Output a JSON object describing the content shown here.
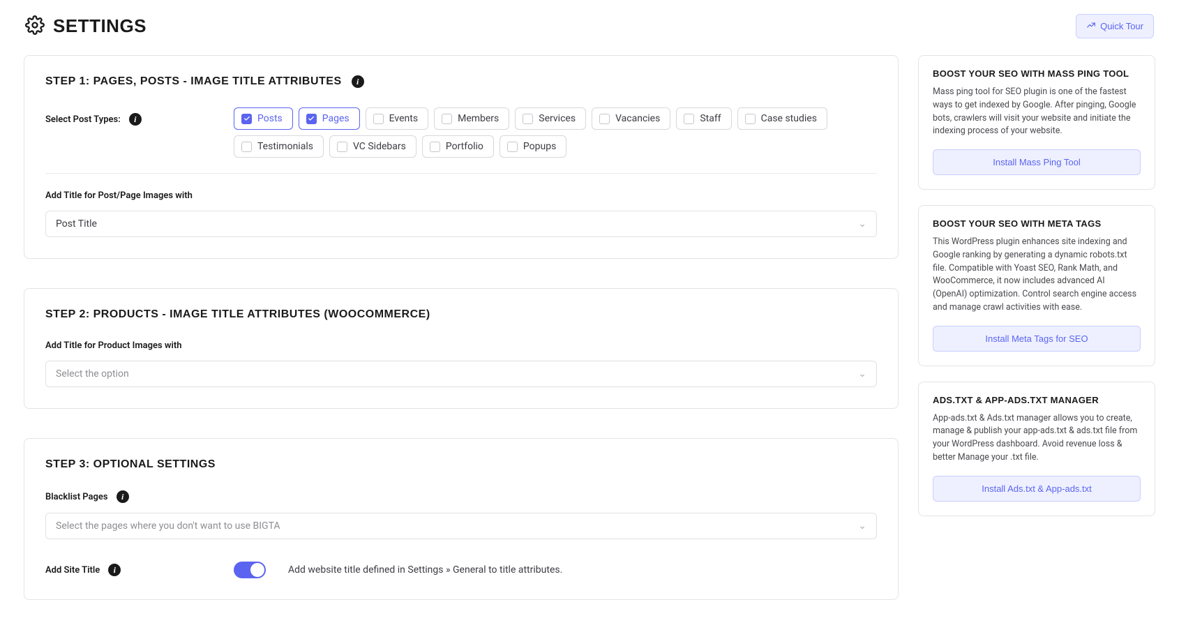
{
  "header": {
    "title": "SETTINGS",
    "quick_tour_label": "Quick Tour"
  },
  "step1": {
    "title": "STEP 1: PAGES, POSTS - IMAGE TITLE ATTRIBUTES",
    "select_post_types_label": "Select Post Types:",
    "post_types": [
      {
        "label": "Posts",
        "checked": true
      },
      {
        "label": "Pages",
        "checked": true
      },
      {
        "label": "Events",
        "checked": false
      },
      {
        "label": "Members",
        "checked": false
      },
      {
        "label": "Services",
        "checked": false
      },
      {
        "label": "Vacancies",
        "checked": false
      },
      {
        "label": "Staff",
        "checked": false
      },
      {
        "label": "Case studies",
        "checked": false
      },
      {
        "label": "Testimonials",
        "checked": false
      },
      {
        "label": "VC Sidebars",
        "checked": false
      },
      {
        "label": "Portfolio",
        "checked": false
      },
      {
        "label": "Popups",
        "checked": false
      }
    ],
    "add_title_label": "Add Title for Post/Page Images with",
    "add_title_value": "Post Title"
  },
  "step2": {
    "title": "STEP 2: PRODUCTS - IMAGE TITLE ATTRIBUTES (WOOCOMMERCE)",
    "add_title_label": "Add Title for Product Images with",
    "add_title_placeholder": "Select the option"
  },
  "step3": {
    "title": "STEP 3: OPTIONAL SETTINGS",
    "blacklist_label": "Blacklist Pages",
    "blacklist_placeholder": "Select the pages where you don't want to use BIGTA",
    "add_site_title_label": "Add Site Title",
    "add_site_title_enabled": true,
    "add_site_title_desc": "Add website title defined in Settings » General to title attributes."
  },
  "sidebar": {
    "cards": [
      {
        "title": "BOOST YOUR SEO WITH MASS PING TOOL",
        "desc": "Mass ping tool for SEO plugin is one of the fastest ways to get indexed by Google. After pinging, Google bots, crawlers will visit your website and initiate the indexing process of your website.",
        "button": "Install Mass Ping Tool"
      },
      {
        "title": "BOOST YOUR SEO WITH META TAGS",
        "desc": "This WordPress plugin enhances site indexing and Google ranking by generating a dynamic robots.txt file. Compatible with Yoast SEO, Rank Math, and WooCommerce, it now includes advanced AI (OpenAI) optimization. Control search engine access and manage crawl activities with ease.",
        "button": "Install Meta Tags for SEO"
      },
      {
        "title": "ADS.TXT & APP-ADS.TXT MANAGER",
        "desc": "App-ads.txt & Ads.txt manager allows you to create, manage & publish your app-ads.txt & ads.txt file from your WordPress dashboard. Avoid revenue loss & better Manage your .txt file.",
        "button": "Install Ads.txt & App-ads.txt"
      }
    ]
  }
}
